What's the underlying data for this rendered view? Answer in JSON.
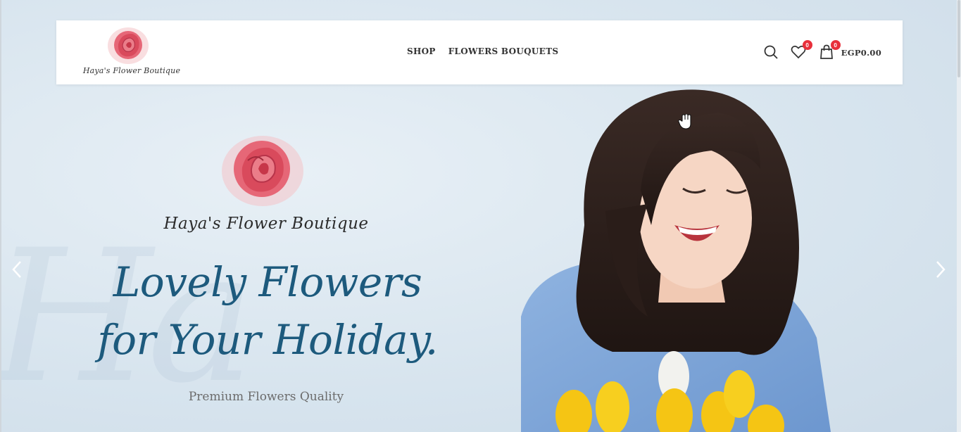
{
  "header": {
    "logo_text": "Haya's Flower Boutique",
    "nav": [
      {
        "label": "SHOP"
      },
      {
        "label": "FLOWERS BOUQUETS"
      }
    ],
    "wishlist_count": "0",
    "cart_count": "0",
    "cart_total": "EGP0.00"
  },
  "hero": {
    "brand": "Haya's Flower Boutique",
    "title_line1": "Lovely Flowers",
    "title_line2": "for Your Holiday.",
    "subtitle": "Premium Flowers Quality"
  },
  "colors": {
    "accent_rose": "#e04a5a",
    "title_blue": "#1d5a7d",
    "badge_red": "#e8303b",
    "sweater_blue": "#7fa6d8",
    "tulip_yellow": "#f5c514"
  },
  "icons": {
    "search": "search-icon",
    "wishlist": "heart-icon",
    "cart": "shopping-bag-icon",
    "prev": "chevron-left-icon",
    "next": "chevron-right-icon"
  }
}
